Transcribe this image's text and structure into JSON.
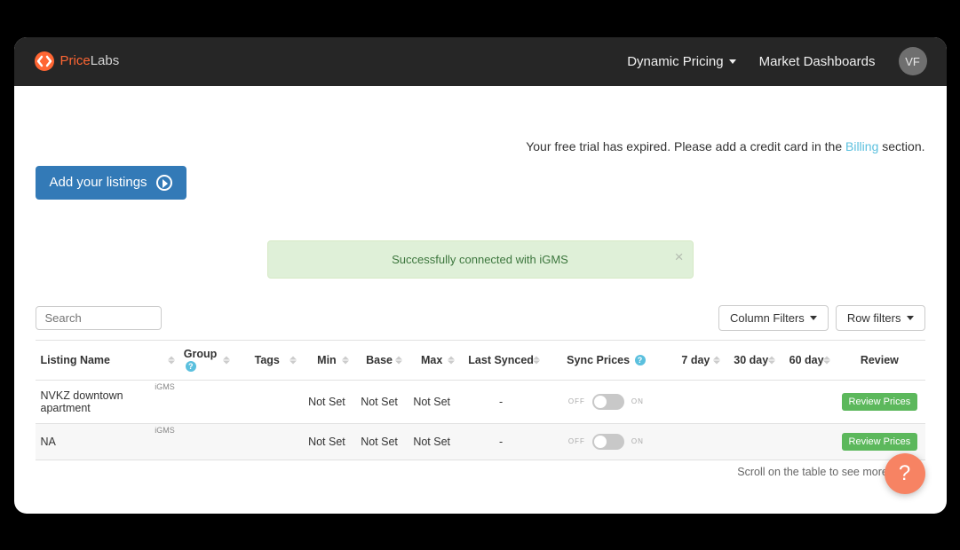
{
  "brand": {
    "p1": "Price",
    "p2": "Labs"
  },
  "nav": {
    "dynamic_pricing": "Dynamic Pricing",
    "market_dashboards": "Market Dashboards",
    "avatar_initials": "VF"
  },
  "trial": {
    "prefix": "Your free trial has expired. Please add a credit card in the ",
    "link": "Billing",
    "suffix": " section."
  },
  "add_listings_label": "Add your listings",
  "alert_text": "Successfully connected with iGMS",
  "toolbar": {
    "search_placeholder": "Search",
    "column_filters": "Column Filters",
    "row_filters": "Row filters"
  },
  "headers": {
    "listing": "Listing Name",
    "group": "Group",
    "tags": "Tags",
    "min": "Min",
    "base": "Base",
    "max": "Max",
    "last_synced": "Last Synced",
    "sync_prices": "Sync Prices",
    "d7": "7 day",
    "d30": "30 day",
    "d60": "60 day",
    "review": "Review"
  },
  "rows": [
    {
      "name": "NVKZ downtown apartment",
      "pms": "iGMS",
      "min": "Not Set",
      "base": "Not Set",
      "max": "Not Set",
      "last_synced": "-",
      "d7": "",
      "d30": "",
      "d60": "",
      "review_label": "Review Prices"
    },
    {
      "name": "NA",
      "pms": "iGMS",
      "min": "Not Set",
      "base": "Not Set",
      "max": "Not Set",
      "last_synced": "-",
      "d7": "",
      "d30": "",
      "d60": "",
      "review_label": "Review Prices"
    }
  ],
  "toggle_labels": {
    "off": "OFF",
    "on": "ON"
  },
  "scroll_hint": "Scroll on the table to see more listings",
  "help_fab": "?"
}
